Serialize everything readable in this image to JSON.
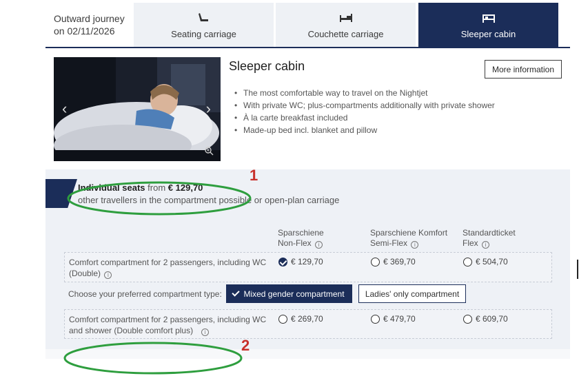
{
  "journey": {
    "line1": "Outward journey",
    "line2": "on 02/11/2026"
  },
  "tabs": [
    {
      "label": "Seating carriage",
      "icon": "seat-icon",
      "active": false
    },
    {
      "label": "Couchette carriage",
      "icon": "couchette-icon",
      "active": false
    },
    {
      "label": "Sleeper cabin",
      "icon": "bed-icon",
      "active": true
    }
  ],
  "detail": {
    "title": "Sleeper cabin",
    "more_info": "More information",
    "features": [
      "The most comfortable way to travel on the Nightjet",
      "With private WC; plus-compartments additionally with private shower",
      "À la carte breakfast included",
      "Made-up bed incl. blanket and pillow"
    ]
  },
  "offer": {
    "title": "Individual seats",
    "from": "from",
    "price": "€ 129,70",
    "subtitle": "other travellers in the compartment possible or open-plan carriage"
  },
  "columns": [
    {
      "line1": "Sparschiene",
      "line2": "Non-Flex"
    },
    {
      "line1": "Sparschiene Komfort",
      "line2": "Semi-Flex"
    },
    {
      "line1": "Standardticket",
      "line2": "Flex"
    }
  ],
  "rows": [
    {
      "label_line1": "Comfort compartment for 2 passengers, including WC",
      "label_line2": "(Double)",
      "prices": [
        "€ 129,70",
        "€ 369,70",
        "€ 504,70"
      ],
      "selected_index": 0
    },
    {
      "label_line1": "Comfort compartment for 2 passengers, including WC",
      "label_line2": "and shower (Double comfort plus)",
      "prices": [
        "€ 269,70",
        "€ 479,70",
        "€ 609,70"
      ],
      "selected_index": -1
    }
  ],
  "compartment_type": {
    "label": "Choose your preferred compartment type:",
    "mixed": "Mixed gender compartment",
    "ladies": "Ladies' only compartment"
  },
  "annotations": {
    "num1": "1",
    "num2": "2"
  },
  "colors": {
    "navy": "#1b2d59",
    "annotation_red": "#c8302b",
    "annotation_green": "#2e9e3e"
  }
}
